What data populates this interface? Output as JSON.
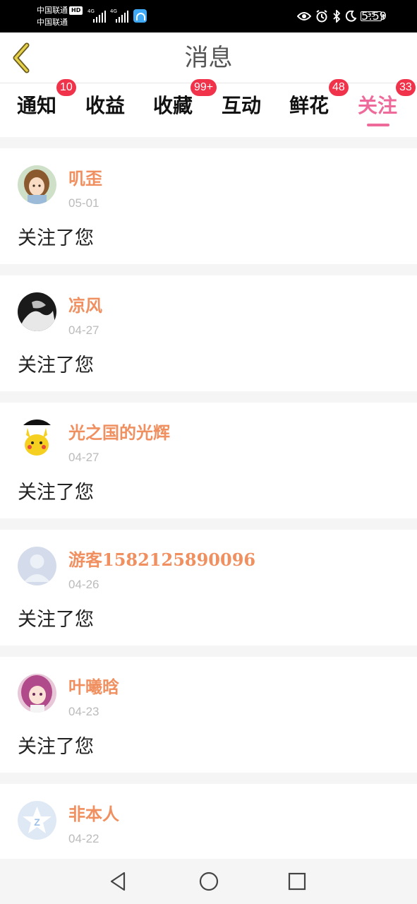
{
  "status_bar": {
    "carrier_primary": "中国联通",
    "carrier_hd": "HD",
    "carrier_secondary": "中国联通",
    "network_1": "4G",
    "network_2": "4G",
    "battery_level": "35",
    "time": "5:59",
    "icons": [
      "eye-icon",
      "alarm-icon",
      "bluetooth-icon",
      "moon-icon"
    ]
  },
  "header": {
    "back_icon": "chevron-left-icon",
    "title": "消息",
    "accent_color": "#e6d24a"
  },
  "tabs": [
    {
      "label": "通知",
      "badge": "10"
    },
    {
      "label": "收益",
      "badge": ""
    },
    {
      "label": "收藏",
      "badge": "99+"
    },
    {
      "label": "互动",
      "badge": ""
    },
    {
      "label": "鲜花",
      "badge": "48"
    },
    {
      "label": "关注",
      "badge": "33",
      "active": true
    }
  ],
  "colors": {
    "active_tab": "#ee6a9a",
    "badge": "#f0334a",
    "username": "#f09060",
    "date": "#bbbbbb"
  },
  "notifications": [
    {
      "username": "叽歪",
      "date": "05-01",
      "action": "关注了您",
      "avatar": "anime-girl-avatar"
    },
    {
      "username": "凉风",
      "date": "04-27",
      "action": "关注了您",
      "avatar": "dark-photo-avatar"
    },
    {
      "username": "光之国的光辉",
      "date": "04-27",
      "action": "关注了您",
      "avatar": "pikachu-avatar"
    },
    {
      "username": "游客1582125890096",
      "date": "04-26",
      "action": "关注了您",
      "avatar": "default-user-avatar"
    },
    {
      "username": "叶曦晗",
      "date": "04-23",
      "action": "关注了您",
      "avatar": "pink-hair-avatar"
    },
    {
      "username": "非本人",
      "date": "04-22",
      "action": "",
      "avatar": "star-logo-avatar"
    }
  ],
  "nav_bar": {
    "back": "triangle-back-icon",
    "home": "circle-home-icon",
    "recents": "square-recents-icon"
  }
}
